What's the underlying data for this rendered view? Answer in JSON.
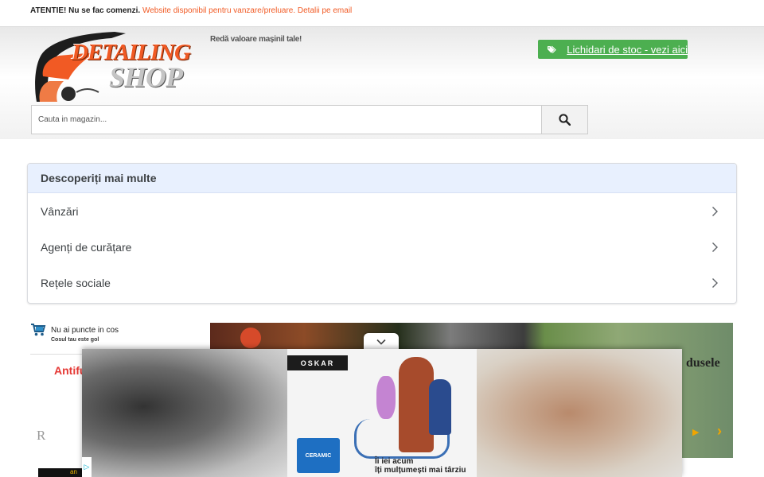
{
  "notice": {
    "strong": "ATENTIE! Nu se fac comenzi.",
    "accent": "Website disponibil pentru vanzare/preluare. Detalii pe email"
  },
  "header": {
    "logo_word1": "DETAILING",
    "logo_word2": "SHOP",
    "tagline": "Redă valoare mașinil tale!",
    "stock_button": "Lichidari de stoc - vezi aici",
    "search_placeholder": "Cauta in magazin..."
  },
  "discover": {
    "title": "Descoperiți mai multe",
    "items": [
      {
        "label": "Vânzări"
      },
      {
        "label": "Agenți de curățare"
      },
      {
        "label": "Rețele sociale"
      }
    ]
  },
  "cart": {
    "title": "Nu ai puncte in cos",
    "subtitle": "Cosul tau este gol"
  },
  "sidebar": {
    "antifog": "Antifu",
    "r_mark": "R",
    "black_banner": "an"
  },
  "slider": {
    "caption": "dusele"
  },
  "ad": {
    "brand": "OSKAR",
    "bucket_label": "CERAMIC",
    "copy_line1": "Îi iei acum",
    "copy_line2": "îți mulțumești mai târziu"
  },
  "colors": {
    "accent_orange": "#f15a24",
    "stock_green": "#4caf50",
    "discover_head": "#e8f0fe"
  },
  "icons": {
    "tag": "tag-icon",
    "search": "search-icon",
    "chevron": "chevron-right-icon",
    "cart": "cart-icon",
    "collapse": "chevron-down-icon"
  }
}
